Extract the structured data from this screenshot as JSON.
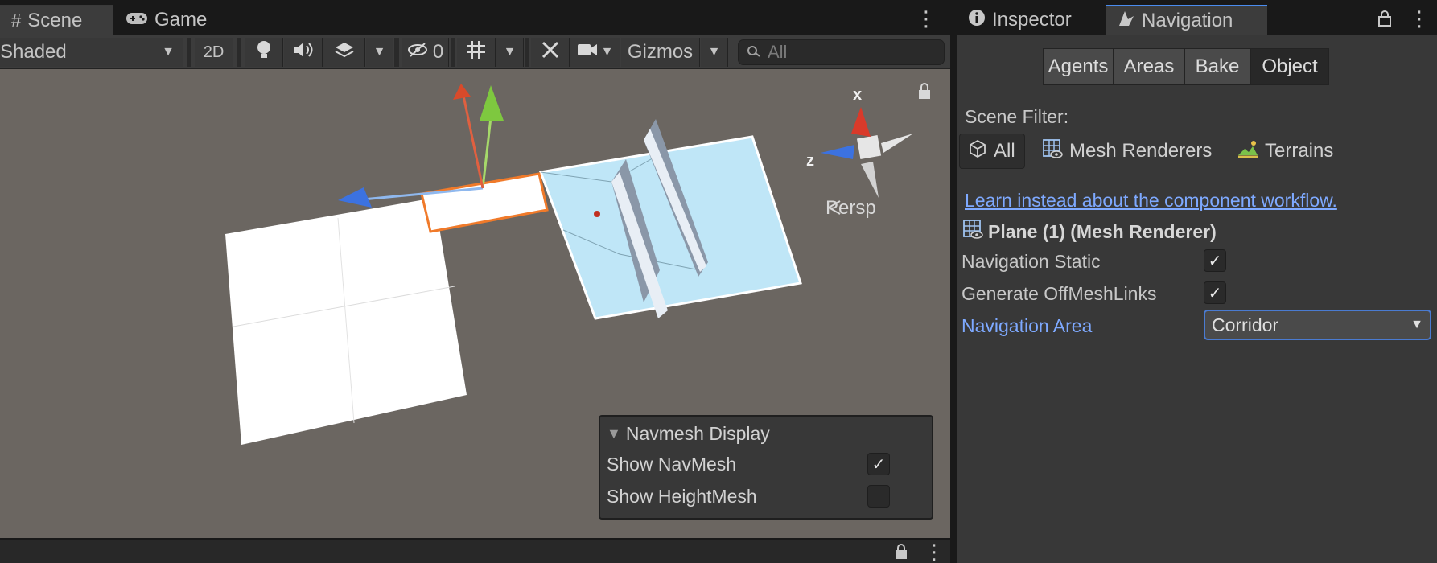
{
  "scene_window": {
    "tabs": [
      {
        "label": "Scene",
        "icon": "grid-icon",
        "active": true
      },
      {
        "label": "Game",
        "icon": "gamepad-icon",
        "active": false
      }
    ],
    "toolbar": {
      "shading_mode": "Shaded",
      "mode_2d_label": "2D",
      "hidden_count": "0",
      "gizmos_label": "Gizmos",
      "search_placeholder": "All"
    },
    "viewport": {
      "axis_x_label": "x",
      "axis_z_label": "z",
      "projection_label": "Persp",
      "colors": {
        "background": "#6b6661",
        "navmesh": "#bfe6f7",
        "selection": "#f07a2a"
      }
    },
    "navmesh_overlay": {
      "title": "Navmesh Display",
      "rows": [
        {
          "label": "Show NavMesh",
          "checked": true
        },
        {
          "label": "Show HeightMesh",
          "checked": false
        }
      ]
    }
  },
  "right_window": {
    "tabs": [
      {
        "label": "Inspector",
        "icon": "info-icon",
        "active": false
      },
      {
        "label": "Navigation",
        "icon": "navigation-icon",
        "active": true
      }
    ],
    "segmented": [
      {
        "label": "Agents",
        "selected": false
      },
      {
        "label": "Areas",
        "selected": false
      },
      {
        "label": "Bake",
        "selected": false
      },
      {
        "label": "Object",
        "selected": true
      }
    ],
    "scene_filter_label": "Scene Filter:",
    "scene_filters": [
      {
        "label": "All",
        "icon": "cube-icon",
        "selected": true
      },
      {
        "label": "Mesh Renderers",
        "icon": "mesh-renderer-icon",
        "selected": false
      },
      {
        "label": "Terrains",
        "icon": "terrain-icon",
        "selected": false
      }
    ],
    "learn_link": "Learn instead about the component workflow.",
    "object_title": "Plane (1) (Mesh Renderer)",
    "properties": [
      {
        "label": "Navigation Static",
        "checked": true
      },
      {
        "label": "Generate OffMeshLinks",
        "checked": true
      }
    ],
    "navigation_area": {
      "label": "Navigation Area",
      "value": "Corridor"
    }
  }
}
